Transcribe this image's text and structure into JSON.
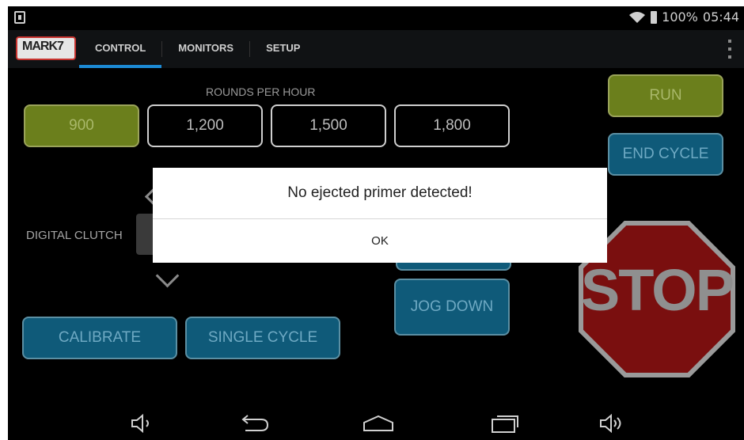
{
  "status": {
    "battery": "100%",
    "time": "05:44"
  },
  "logo": {
    "text": "MARK7"
  },
  "tabs": [
    {
      "label": "CONTROL",
      "active": true
    },
    {
      "label": "MONITORS",
      "active": false
    },
    {
      "label": "SETUP",
      "active": false
    }
  ],
  "control": {
    "rounds_label": "ROUNDS PER HOUR",
    "rph_options": [
      "900",
      "1,200",
      "1,500",
      "1,800"
    ],
    "rph_selected": "900",
    "run_label": "RUN",
    "end_cycle_label": "END CYCLE",
    "clutch_label": "DIGITAL CLUTCH",
    "jog_down_label": "JOG DOWN",
    "calibrate_label": "CALIBRATE",
    "single_cycle_label": "SINGLE CYCLE",
    "stop_label": "STOP"
  },
  "dialog": {
    "message": "No ejected primer detected!",
    "ok_label": "OK"
  },
  "colors": {
    "accent": "#1c8ad4",
    "green": "#6b7f1c",
    "blue": "#0f5a79",
    "stop_red": "#7a0f0f"
  }
}
